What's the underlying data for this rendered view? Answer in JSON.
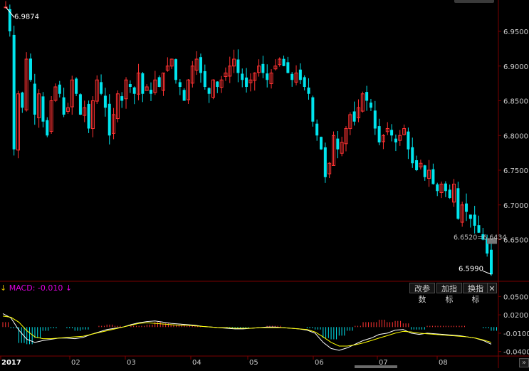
{
  "chart_data": {
    "type": "candlestick",
    "price_axis": {
      "ticks": [
        "6.9500",
        "6.9000",
        "6.8500",
        "6.8000",
        "6.7500",
        "6.7000",
        "6.6500"
      ],
      "min": 6.59,
      "max": 6.99
    },
    "x_labels": [
      "2017",
      "02",
      "03",
      "04",
      "05",
      "06",
      "07",
      "08"
    ],
    "high_label": "6.9874",
    "low_label": "6.5990",
    "price_tag": "6.6520=6.6434",
    "closes": [
      6.985,
      6.95,
      6.78,
      6.86,
      6.84,
      6.91,
      6.88,
      6.83,
      6.86,
      6.82,
      6.8,
      6.85,
      6.87,
      6.86,
      6.83,
      6.84,
      6.88,
      6.86,
      6.83,
      6.84,
      6.81,
      6.85,
      6.88,
      6.86,
      6.84,
      6.8,
      6.83,
      6.86,
      6.85,
      6.88,
      6.87,
      6.86,
      6.89,
      6.86,
      6.87,
      6.86,
      6.88,
      6.87,
      6.89,
      6.9,
      6.91,
      6.88,
      6.87,
      6.85,
      6.88,
      6.9,
      6.91,
      6.89,
      6.87,
      6.86,
      6.88,
      6.87,
      6.88,
      6.89,
      6.9,
      6.91,
      6.89,
      6.88,
      6.87,
      6.88,
      6.89,
      6.9,
      6.89,
      6.88,
      6.89,
      6.9,
      6.91,
      6.9,
      6.89,
      6.88,
      6.89,
      6.88,
      6.87,
      6.86,
      6.82,
      6.8,
      6.78,
      6.74,
      6.76,
      6.8,
      6.78,
      6.79,
      6.81,
      6.83,
      6.82,
      6.84,
      6.86,
      6.85,
      6.84,
      6.81,
      6.79,
      6.8,
      6.81,
      6.8,
      6.79,
      6.8,
      6.81,
      6.78,
      6.76,
      6.75,
      6.76,
      6.74,
      6.75,
      6.73,
      6.72,
      6.73,
      6.72,
      6.71,
      6.73,
      6.68,
      6.7,
      6.69,
      6.68,
      6.67,
      6.66,
      6.65,
      6.63,
      6.6
    ],
    "macd": {
      "label": "MACD: -0.010",
      "axis_ticks": [
        "0.0500",
        "0.0200",
        "-0.0100",
        "-0.0400"
      ],
      "dif": [
        0.022,
        0.015,
        -0.005,
        -0.02,
        -0.025,
        -0.022,
        -0.02,
        -0.018,
        -0.018,
        -0.019,
        -0.017,
        -0.012,
        -0.008,
        -0.004,
        -0.002,
        0.0,
        0.004,
        0.007,
        0.009,
        0.01,
        0.008,
        0.006,
        0.005,
        0.004,
        0.003,
        0.001,
        0.0,
        -0.001,
        -0.002,
        -0.003,
        -0.003,
        -0.002,
        -0.001,
        0.0,
        0.0,
        -0.001,
        -0.002,
        -0.003,
        -0.005,
        -0.01,
        -0.025,
        -0.035,
        -0.038,
        -0.034,
        -0.028,
        -0.022,
        -0.018,
        -0.012,
        -0.01,
        -0.005,
        -0.004,
        -0.01,
        -0.012,
        -0.01,
        -0.011,
        -0.012,
        -0.013,
        -0.014,
        -0.016,
        -0.018,
        -0.022,
        -0.028
      ],
      "dea": [
        0.018,
        0.016,
        0.008,
        -0.006,
        -0.016,
        -0.019,
        -0.019,
        -0.018,
        -0.017,
        -0.016,
        -0.015,
        -0.012,
        -0.009,
        -0.006,
        -0.003,
        0.0,
        0.003,
        0.006,
        0.007,
        0.006,
        0.005,
        0.004,
        0.003,
        0.003,
        0.002,
        0.001,
        0.0,
        -0.001,
        -0.001,
        -0.002,
        -0.002,
        -0.002,
        -0.001,
        -0.001,
        -0.001,
        -0.001,
        -0.002,
        -0.003,
        -0.004,
        -0.008,
        -0.016,
        -0.025,
        -0.031,
        -0.031,
        -0.029,
        -0.026,
        -0.022,
        -0.018,
        -0.014,
        -0.01,
        -0.007,
        -0.008,
        -0.01,
        -0.011,
        -0.012,
        -0.013,
        -0.014,
        -0.015,
        -0.016,
        -0.018,
        -0.021,
        -0.025
      ]
    }
  },
  "toolbar": {
    "change_params": "改参数",
    "add_indicator": "加指标",
    "switch_indicator": "换指标",
    "close": "✕",
    "scroll_right": "»"
  },
  "colors": {
    "up": "#ff3232",
    "down": "#00e5ee",
    "dif": "#ffffff",
    "dea": "#ffff00",
    "grid": "#3a0000",
    "axis": "#7a0000"
  }
}
